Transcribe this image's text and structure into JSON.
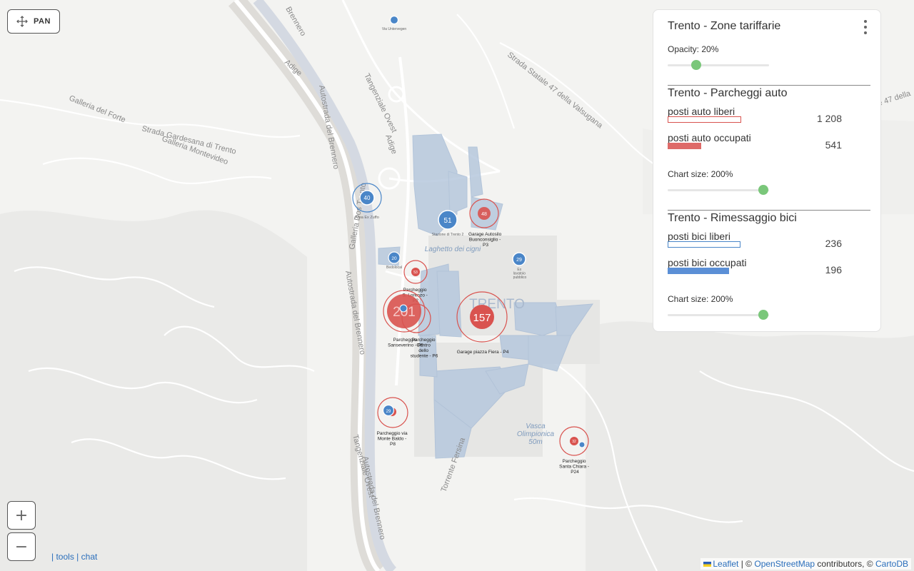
{
  "map": {
    "labels": {
      "street1": "Strada Gardesana di Trento",
      "street2": "Galleria del Forte",
      "street3": "Galleria Montevideo",
      "street4": "Autostrada del Brennero",
      "street5": "Tangenziale Ovest",
      "street6": "Strada Statale 47 della Valsugana",
      "street7": "Adige",
      "street8": "Torrente Fersina",
      "street9": "Galleria Dos Trento",
      "street10": "Strada Statale 47 della",
      "lake": "Laghetto dei cigni",
      "city": "TRENTO",
      "pool1": "Vasca",
      "pool2": "Olimpionica",
      "pool3": "50m",
      "adige2": "Adige",
      "brennero_top": "Brennero"
    },
    "markers": [
      {
        "kind": "bike",
        "value": "40",
        "label": "Area Ex Zuffo"
      },
      {
        "kind": "bike",
        "value": "51",
        "label": "Stazione di Trento 2"
      },
      {
        "kind": "car",
        "value": "48",
        "label": "Garage Autosilo Buonconsiglio - P3"
      },
      {
        "kind": "bike",
        "value": "20",
        "label": "Bedolocal"
      },
      {
        "kind": "bike",
        "value": "29",
        "label": "Ex lavatoio pubblico"
      },
      {
        "kind": "car",
        "value": "53",
        "label": "Parcheggio S. Lorenzo - P2"
      },
      {
        "kind": "car",
        "value": "201",
        "label": "Parcheggio Sanseverino - P5"
      },
      {
        "kind": "car",
        "value": "",
        "label": "Parcheggio Centro dello studente - P6"
      },
      {
        "kind": "car",
        "value": "157",
        "label": "Garage piazza Fiera - P4"
      },
      {
        "kind": "bike",
        "value": "29",
        "label": "Parcheggio via Monte Baldo - P8"
      },
      {
        "kind": "car",
        "value": "32",
        "label": "Parcheggio Santa Chiara - P24"
      },
      {
        "kind": "bike",
        "value": "",
        "label": "Via Untervegen"
      }
    ]
  },
  "controls": {
    "pan_label": "PAN",
    "zoom_in": "+",
    "zoom_out": "−",
    "tools": "tools",
    "chat": "chat"
  },
  "attribution": {
    "leaflet": "Leaflet",
    "sep1": "| ©",
    "osm": "OpenStreetMap",
    "middle": "contributors, ©",
    "carto": "CartoDB"
  },
  "legend": {
    "zones": {
      "title": "Trento - Zone tariffarie",
      "opacity_label": "Opacity: 20%",
      "opacity_value": 0.2
    },
    "cars": {
      "title": "Trento - Parcheggi auto",
      "free_label": "posti auto liberi",
      "free_value": "1 208",
      "occupied_label": "posti auto occupati",
      "occupied_value": "541",
      "chart_size_label": "Chart size: 200%",
      "chart_size_value": 2.0,
      "free_color": "#d9534f",
      "occupied_color": "#de6a68"
    },
    "bikes": {
      "title": "Trento - Rimessaggio bici",
      "free_label": "posti bici liberi",
      "free_value": "236",
      "occupied_label": "posti bici occupati",
      "occupied_value": "196",
      "chart_size_label": "Chart size: 200%",
      "chart_size_value": 2.0,
      "free_color": "#4a86c8",
      "occupied_color": "#5b8fd6"
    }
  },
  "colors": {
    "zone_fill": "#b7c8dd",
    "car": "#d9534f",
    "bike": "#4a86c8",
    "slider": "#7ac77a"
  }
}
